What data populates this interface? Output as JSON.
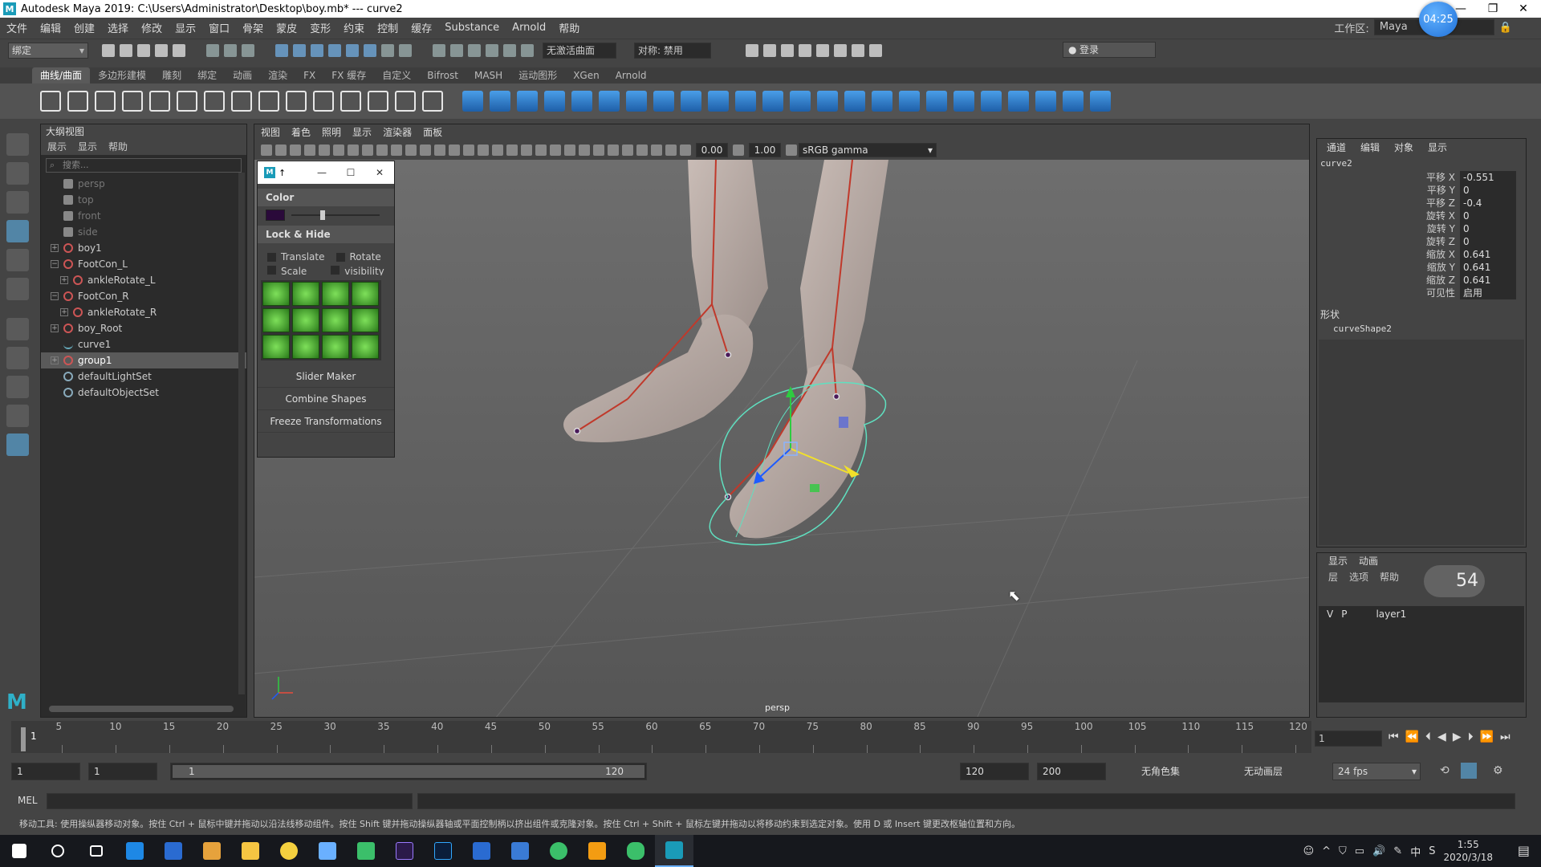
{
  "window": {
    "title": "Autodesk Maya 2019: C:\\Users\\Administrator\\Desktop\\boy.mb*   ---   curve2",
    "app_icon": "M",
    "clock_bubble": "04:25"
  },
  "menubar": {
    "items": [
      "文件",
      "编辑",
      "创建",
      "选择",
      "修改",
      "显示",
      "窗口",
      "骨架",
      "蒙皮",
      "变形",
      "约束",
      "控制",
      "缓存",
      "Substance",
      "Arnold",
      "帮助"
    ],
    "workspace_label": "工作区:",
    "workspace_value": "Maya"
  },
  "statusline": {
    "mode": "绑定",
    "live_surface": "无激活曲面",
    "symmetry": "对称: 禁用",
    "login": "登录"
  },
  "shelf": {
    "tabs": [
      "曲线/曲面",
      "多边形建模",
      "雕刻",
      "绑定",
      "动画",
      "渲染",
      "FX",
      "FX 缓存",
      "自定义",
      "Bifrost",
      "MASH",
      "运动图形",
      "XGen",
      "Arnold"
    ],
    "active_tab": 0
  },
  "outliner": {
    "title": "大纲视图",
    "menu": [
      "展示",
      "显示",
      "帮助"
    ],
    "search_placeholder": "搜索...",
    "items": [
      {
        "label": "persp",
        "indent": 0,
        "icon": "camera-icon",
        "dim": true,
        "expand": ""
      },
      {
        "label": "top",
        "indent": 0,
        "icon": "camera-icon",
        "dim": true,
        "expand": ""
      },
      {
        "label": "front",
        "indent": 0,
        "icon": "camera-icon",
        "dim": true,
        "expand": ""
      },
      {
        "label": "side",
        "indent": 0,
        "icon": "camera-icon",
        "dim": true,
        "expand": ""
      },
      {
        "label": "boy1",
        "indent": 0,
        "icon": "joint-icon",
        "dim": false,
        "expand": "+"
      },
      {
        "label": "FootCon_L",
        "indent": 0,
        "icon": "joint-icon",
        "dim": false,
        "expand": "−"
      },
      {
        "label": "ankleRotate_L",
        "indent": 1,
        "icon": "joint-icon",
        "dim": false,
        "expand": "+"
      },
      {
        "label": "FootCon_R",
        "indent": 0,
        "icon": "joint-icon",
        "dim": false,
        "expand": "−"
      },
      {
        "label": "ankleRotate_R",
        "indent": 1,
        "icon": "joint-icon",
        "dim": false,
        "expand": "+"
      },
      {
        "label": "boy_Root",
        "indent": 0,
        "icon": "joint-icon",
        "dim": false,
        "expand": "+"
      },
      {
        "label": "curve1",
        "indent": 0,
        "icon": "curve-icon",
        "dim": false,
        "expand": ""
      },
      {
        "label": "group1",
        "indent": 0,
        "icon": "joint-icon",
        "dim": false,
        "expand": "+",
        "selected": true
      },
      {
        "label": "defaultLightSet",
        "indent": 0,
        "icon": "set-icon",
        "dim": false,
        "expand": ""
      },
      {
        "label": "defaultObjectSet",
        "indent": 0,
        "icon": "set-icon",
        "dim": false,
        "expand": ""
      }
    ]
  },
  "viewport": {
    "menu": [
      "视图",
      "着色",
      "照明",
      "显示",
      "渲染器",
      "面板"
    ],
    "exposure": "0.00",
    "gamma": "1.00",
    "color_space": "sRGB gamma",
    "camera_label": "persp"
  },
  "floatwin": {
    "logo": "M",
    "title_suffix": "↑",
    "color_label": "Color",
    "lock_hide_label": "Lock & Hide",
    "checks": [
      "Translate",
      "Rotate",
      "Scale",
      "visibility"
    ],
    "buttons": [
      "Slider Maker",
      "Combine Shapes",
      "Freeze Transformations"
    ]
  },
  "channelbox": {
    "menu": [
      "通道",
      "编辑",
      "对象",
      "显示"
    ],
    "object": "curve2",
    "attributes": [
      {
        "label": "平移 X",
        "value": "-0.551"
      },
      {
        "label": "平移 Y",
        "value": "0"
      },
      {
        "label": "平移 Z",
        "value": "-0.4"
      },
      {
        "label": "旋转 X",
        "value": "0"
      },
      {
        "label": "旋转 Y",
        "value": "0"
      },
      {
        "label": "旋转 Z",
        "value": "0"
      },
      {
        "label": "缩放 X",
        "value": "0.641"
      },
      {
        "label": "缩放 Y",
        "value": "0.641"
      },
      {
        "label": "缩放 Z",
        "value": "0.641"
      },
      {
        "label": "可见性",
        "value": "启用"
      }
    ],
    "shapes_label": "形状",
    "shape_name": "curveShape2"
  },
  "layer_editor": {
    "tabs": [
      "显示",
      "动画"
    ],
    "menu": [
      "层",
      "选项",
      "帮助"
    ],
    "layers": [
      {
        "v": "V",
        "p": "P",
        "name": "layer1"
      }
    ],
    "net_widget": "54"
  },
  "timeline": {
    "current_frame": "1",
    "ticks": [
      "5",
      "10",
      "15",
      "20",
      "25",
      "30",
      "35",
      "40",
      "45",
      "50",
      "55",
      "60",
      "65",
      "70",
      "75",
      "80",
      "85",
      "90",
      "95",
      "100",
      "105",
      "110",
      "115",
      "120"
    ],
    "frame_field": "1"
  },
  "range": {
    "start": "1",
    "anim_start": "1",
    "slider_start": "1",
    "slider_end": "120",
    "end": "120",
    "anim_end": "200",
    "char_set": "无角色集",
    "anim_layer": "无动画层",
    "fps": "24 fps"
  },
  "mel": {
    "label": "MEL"
  },
  "helpline": "移动工具: 使用操纵器移动对象。按住 Ctrl + 鼠标中键并拖动以沿法线移动组件。按住 Shift 键并拖动操纵器轴或平面控制柄以挤出组件或克隆对象。按住 Ctrl + Shift + 鼠标左键并拖动以将移动约束到选定对象。使用 D 或 Insert 键更改枢轴位置和方向。",
  "taskbar": {
    "tray_ime": "中",
    "time": "1:55",
    "date": "2020/3/18"
  }
}
